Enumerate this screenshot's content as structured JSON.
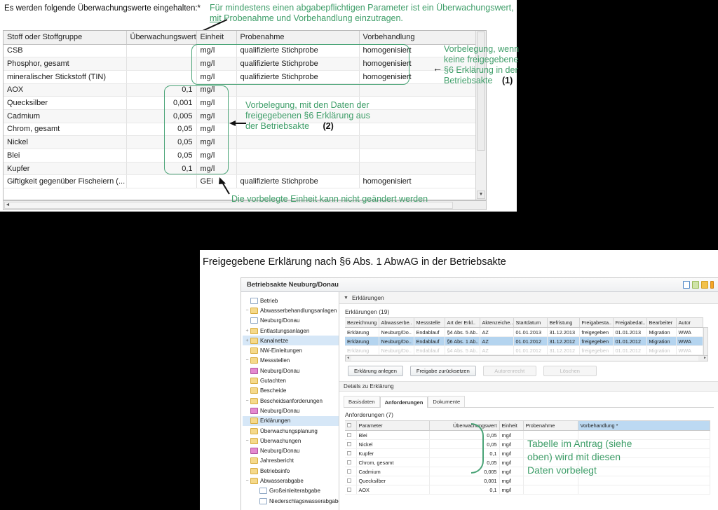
{
  "top_panel": {
    "intro_label": "Es werden folgende Überwachungswerte eingehalten:*",
    "annotation_top_line1": "Für mindestens einen abgabepflichtigen Parameter ist ein Überwachungswert,",
    "annotation_top_line2_underlined": "mit",
    "annotation_top_line2_rest": " Probenahme und Vorbehandlung  einzutragen.",
    "columns": [
      "Stoff oder Stoffgruppe",
      "Überwachungswert",
      "Einheit",
      "Probenahme",
      "Vorbehandlung"
    ],
    "rows": [
      {
        "name": "CSB",
        "value": "",
        "unit": "mg/l",
        "probe": "qualifizierte Stichprobe",
        "vor": "homogenisiert"
      },
      {
        "name": "Phosphor, gesamt",
        "value": "",
        "unit": "mg/l",
        "probe": "qualifizierte Stichprobe",
        "vor": "homogenisiert"
      },
      {
        "name": "mineralischer Stickstoff (TIN)",
        "value": "",
        "unit": "mg/l",
        "probe": "qualifizierte Stichprobe",
        "vor": "homogenisiert"
      },
      {
        "name": "AOX",
        "value": "0,1",
        "unit": "mg/l",
        "probe": "",
        "vor": ""
      },
      {
        "name": "Quecksilber",
        "value": "0,001",
        "unit": "mg/l",
        "probe": "",
        "vor": ""
      },
      {
        "name": "Cadmium",
        "value": "0,005",
        "unit": "mg/l",
        "probe": "",
        "vor": ""
      },
      {
        "name": "Chrom, gesamt",
        "value": "0,05",
        "unit": "mg/l",
        "probe": "",
        "vor": ""
      },
      {
        "name": "Nickel",
        "value": "0,05",
        "unit": "mg/l",
        "probe": "",
        "vor": ""
      },
      {
        "name": "Blei",
        "value": "0,05",
        "unit": "mg/l",
        "probe": "",
        "vor": ""
      },
      {
        "name": "Kupfer",
        "value": "0,1",
        "unit": "mg/l",
        "probe": "",
        "vor": ""
      },
      {
        "name": "Giftigkeit gegenüber Fischeiern (...",
        "value": "",
        "unit": "GEi",
        "probe": "qualifizierte Stichprobe",
        "vor": "homogenisiert"
      }
    ],
    "annotation_1": {
      "line1": "Vorbelegung, wenn",
      "line2": "keine freigegebene",
      "line3": "§6 Erklärung in der",
      "line4": "Betriebsakte",
      "number": "(1)"
    },
    "annotation_2": {
      "line1": "Vorbelegung, mit den Daten der",
      "line2": "freigegebenen §6 Erklärung aus",
      "line3": "der Betriebsakte",
      "number": "(2)"
    },
    "annotation_3": "Die vorbelegte Einheit kann nicht geändert werden"
  },
  "lower": {
    "caption": "Freigegebene Erklärung nach §6 Abs. 1 AbwAG in der Betriebsakte",
    "window_title": "Betriebsakte Neuburg/Donau",
    "tree": [
      {
        "label": "Betrieb",
        "indent": 0,
        "icon": "document-icon",
        "expander": "",
        "selected": false
      },
      {
        "label": "Abwasserbehandlungsanlagen",
        "indent": 0,
        "icon": "folder-icon",
        "expander": "−",
        "selected": false
      },
      {
        "label": "Neuburg/Donau",
        "indent": 1,
        "icon": "document-icon",
        "expander": "",
        "selected": false
      },
      {
        "label": "Entlastungsanlagen",
        "indent": 0,
        "icon": "folder-icon",
        "expander": "+",
        "selected": false
      },
      {
        "label": "Kanalnetze",
        "indent": 0,
        "icon": "folder-icon",
        "expander": "+",
        "selected": true
      },
      {
        "label": "NW-Einleitungen",
        "indent": 0,
        "icon": "folder-icon",
        "expander": "",
        "selected": false
      },
      {
        "label": "Messstellen",
        "indent": 0,
        "icon": "folder-icon",
        "expander": "−",
        "selected": false
      },
      {
        "label": "Neuburg/Donau",
        "indent": 1,
        "icon": "pin-icon",
        "expander": "",
        "selected": false
      },
      {
        "label": "Gutachten",
        "indent": 0,
        "icon": "folder-icon",
        "expander": "",
        "selected": false
      },
      {
        "label": "Bescheide",
        "indent": 0,
        "icon": "folder-icon",
        "expander": "",
        "selected": false
      },
      {
        "label": "Bescheidsanforderungen",
        "indent": 0,
        "icon": "folder-icon",
        "expander": "−",
        "selected": false
      },
      {
        "label": "Neuburg/Donau",
        "indent": 1,
        "icon": "pin-icon",
        "expander": "",
        "selected": false
      },
      {
        "label": "Erklärungen",
        "indent": 0,
        "icon": "folder-icon",
        "expander": "",
        "selected": true
      },
      {
        "label": "Überwachungsplanung",
        "indent": 0,
        "icon": "folder-icon",
        "expander": "",
        "selected": false
      },
      {
        "label": "Überwachungen",
        "indent": 0,
        "icon": "folder-icon",
        "expander": "−",
        "selected": false
      },
      {
        "label": "Neuburg/Donau",
        "indent": 1,
        "icon": "pin-icon",
        "expander": "",
        "selected": false
      },
      {
        "label": "Jahresbericht",
        "indent": 0,
        "icon": "folder-icon",
        "expander": "",
        "selected": false
      },
      {
        "label": "Betriebsinfo",
        "indent": 0,
        "icon": "folder-icon",
        "expander": "",
        "selected": false
      },
      {
        "label": "Abwasserabgabe",
        "indent": 0,
        "icon": "folder-icon",
        "expander": "−",
        "selected": false
      },
      {
        "label": "Großeinleiterabgabe",
        "indent": 1,
        "icon": "document-icon",
        "expander": "",
        "selected": false
      },
      {
        "label": "Niederschlagswasserabgabe",
        "indent": 1,
        "icon": "document-icon",
        "expander": "",
        "selected": false
      }
    ],
    "section_header": "Erklärungen",
    "erklaerungen_count": "Erklärungen  (19)",
    "erk_columns": [
      "Bezeichnung",
      "Abwasserbe..",
      "Messstelle",
      "Art der Erkl..",
      "Aktenzeiche..",
      "Startdatum",
      "Befristung",
      "Freigabesta..",
      "Freigabedat..",
      "Bearbeiter",
      "Autor"
    ],
    "erk_rows": [
      {
        "cells": [
          "Erklärung",
          "Neuburg/Do..",
          "Endablauf",
          "§4 Abs. 5 Ab..",
          "AZ",
          "01.01.2013",
          "31.12.2013",
          "freigegeben",
          "01.01.2013",
          "Migration",
          "WWA"
        ],
        "highlighted": false
      },
      {
        "cells": [
          "Erklärung",
          "Neuburg/Do..",
          "Endablauf",
          "§6 Abs. 1 Ab..",
          "AZ",
          "01.01.2012",
          "31.12.2012",
          "freigegeben",
          "01.01.2012",
          "Migration",
          "WWA"
        ],
        "highlighted": true
      },
      {
        "cells": [
          "Erklärung",
          "Neuburg/Do..",
          "Endablauf",
          "§4 Abs. 5 Ab..",
          "AZ",
          "01.01.2012",
          "31.12.2012",
          "freigegeben",
          "01.01.2012",
          "Migration",
          "WWA"
        ],
        "highlighted": false
      }
    ],
    "buttons": [
      {
        "label": "Erklärung anlegen",
        "disabled": false
      },
      {
        "label": "Freigabe zurücksetzen",
        "disabled": false
      },
      {
        "label": "Autorenrecht",
        "disabled": true
      },
      {
        "label": "Löschen",
        "disabled": true
      }
    ],
    "details_header": "Details zu Erklärung",
    "tabs": [
      {
        "label": "Basisdaten",
        "active": false
      },
      {
        "label": "Anforderungen",
        "active": true
      },
      {
        "label": "Dokumente",
        "active": false
      }
    ],
    "anf_count": "Anforderungen  (7)",
    "anf_columns": [
      "",
      "Parameter",
      "Überwachungswert",
      "Einheit",
      "Probenahme",
      "Vorbehandlung *"
    ],
    "anf_rows": [
      {
        "param": "Blei",
        "value": "0,05",
        "unit": "mg/l",
        "probe": "",
        "vor": ""
      },
      {
        "param": "Nickel",
        "value": "0,05",
        "unit": "mg/l",
        "probe": "",
        "vor": ""
      },
      {
        "param": "Kupfer",
        "value": "0,1",
        "unit": "mg/l",
        "probe": "",
        "vor": ""
      },
      {
        "param": "Chrom, gesamt",
        "value": "0,05",
        "unit": "mg/l",
        "probe": "",
        "vor": ""
      },
      {
        "param": "Cadmium",
        "value": "0,005",
        "unit": "mg/l",
        "probe": "",
        "vor": ""
      },
      {
        "param": "Quecksilber",
        "value": "0,001",
        "unit": "mg/l",
        "probe": "",
        "vor": ""
      },
      {
        "param": "AOX",
        "value": "0,1",
        "unit": "mg/l",
        "probe": "",
        "vor": ""
      }
    ],
    "annotation_4": {
      "line1": "Tabelle im Antrag (siehe",
      "line2": "oben) wird mit diesen",
      "line3": "Daten vorbelegt"
    }
  },
  "colors": {
    "annotation_green": "#3f9e69",
    "highlight_blue": "#b4d4ef",
    "page_background": "#000000"
  }
}
